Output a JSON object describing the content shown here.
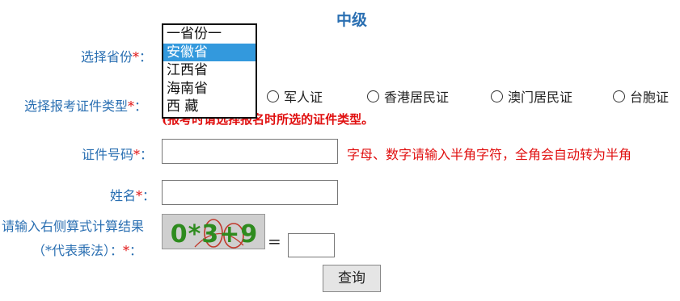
{
  "title": "中级",
  "required_mark": "*",
  "colon": "：",
  "province": {
    "label": "选择省份",
    "options": [
      "一省份一",
      "安徽省",
      "江西省",
      "海南省",
      "西  藏"
    ],
    "selected": "安徽省"
  },
  "id_type": {
    "label": "选择报考证件类型",
    "options": [
      "军人证",
      "香港居民证",
      "澳门居民证",
      "台胞证"
    ],
    "notice": "(报考时请选择报名时所选的证件类型。"
  },
  "id_number": {
    "label": "证件号码",
    "value": "",
    "hint": "字母、数字请输入半角字符，全角会自动转为半角"
  },
  "name": {
    "label": "姓名",
    "value": ""
  },
  "captcha": {
    "label_line1": "请输入右侧算式计算结果",
    "label_line2": "（*代表乘法）：",
    "expression": "0*3+9",
    "equals": "=",
    "answer": ""
  },
  "submit_label": "查询"
}
